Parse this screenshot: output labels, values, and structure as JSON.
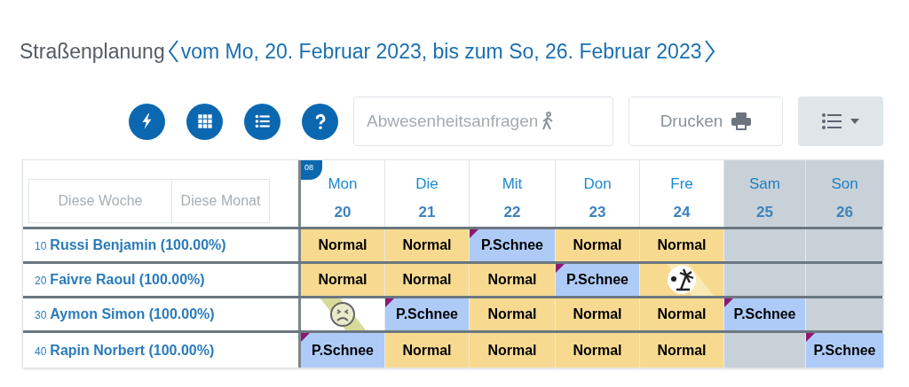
{
  "title": "Straßenplanung",
  "period": "vom Mo, 20. Februar 2023, bis zum So, 26. Februar 2023",
  "toolbar": {
    "icon_buttons": [
      {
        "kind": "bolt"
      },
      {
        "kind": "grid"
      },
      {
        "kind": "list"
      },
      {
        "kind": "help"
      }
    ],
    "absence_requests": {
      "placeholder": "Abwesenheitsanfragen"
    },
    "print_button": "Drucken"
  },
  "table": {
    "filters": [
      "Diese Woche",
      "Diese Monat"
    ],
    "week_badge": "08",
    "days": [
      {
        "name": "Mon",
        "date": "20",
        "weekend": false
      },
      {
        "name": "Die",
        "date": "21",
        "weekend": false
      },
      {
        "name": "Mit",
        "date": "22",
        "weekend": false
      },
      {
        "name": "Don",
        "date": "23",
        "weekend": false
      },
      {
        "name": "Fre",
        "date": "24",
        "weekend": false
      },
      {
        "name": "Sam",
        "date": "25",
        "weekend": true
      },
      {
        "name": "Son",
        "date": "26",
        "weekend": true
      }
    ],
    "rows": [
      {
        "number": "10",
        "name": "Russi Benjamin (100.00%)",
        "cells": [
          {
            "kind": "shift",
            "label": "Normal"
          },
          {
            "kind": "shift",
            "label": "Normal"
          },
          {
            "kind": "absence",
            "label": "P.Schnee"
          },
          {
            "kind": "shift",
            "label": "Normal"
          },
          {
            "kind": "shift",
            "label": "Normal"
          },
          {
            "kind": "empty"
          },
          {
            "kind": "empty"
          }
        ]
      },
      {
        "number": "20",
        "name": "Faivre Raoul (100.00%)",
        "cells": [
          {
            "kind": "shift",
            "label": "Normal"
          },
          {
            "kind": "shift",
            "label": "Normal"
          },
          {
            "kind": "shift",
            "label": "Normal"
          },
          {
            "kind": "absence",
            "label": "P.Schnee"
          },
          {
            "kind": "vacation"
          },
          {
            "kind": "empty"
          },
          {
            "kind": "empty"
          }
        ]
      },
      {
        "number": "30",
        "name": "Aymon Simon (100.00%)",
        "cells": [
          {
            "kind": "sick"
          },
          {
            "kind": "absence",
            "label": "P.Schnee"
          },
          {
            "kind": "shift",
            "label": "Normal"
          },
          {
            "kind": "shift",
            "label": "Normal"
          },
          {
            "kind": "shift",
            "label": "Normal"
          },
          {
            "kind": "absence",
            "label": "P.Schnee"
          },
          {
            "kind": "empty"
          }
        ]
      },
      {
        "number": "40",
        "name": "Rapin Norbert (100.00%)",
        "cells": [
          {
            "kind": "absence",
            "label": "P.Schnee"
          },
          {
            "kind": "shift",
            "label": "Normal"
          },
          {
            "kind": "shift",
            "label": "Normal"
          },
          {
            "kind": "shift",
            "label": "Normal"
          },
          {
            "kind": "shift",
            "label": "Normal"
          },
          {
            "kind": "empty"
          },
          {
            "kind": "absence",
            "label": "P.Schnee"
          }
        ]
      }
    ]
  }
}
